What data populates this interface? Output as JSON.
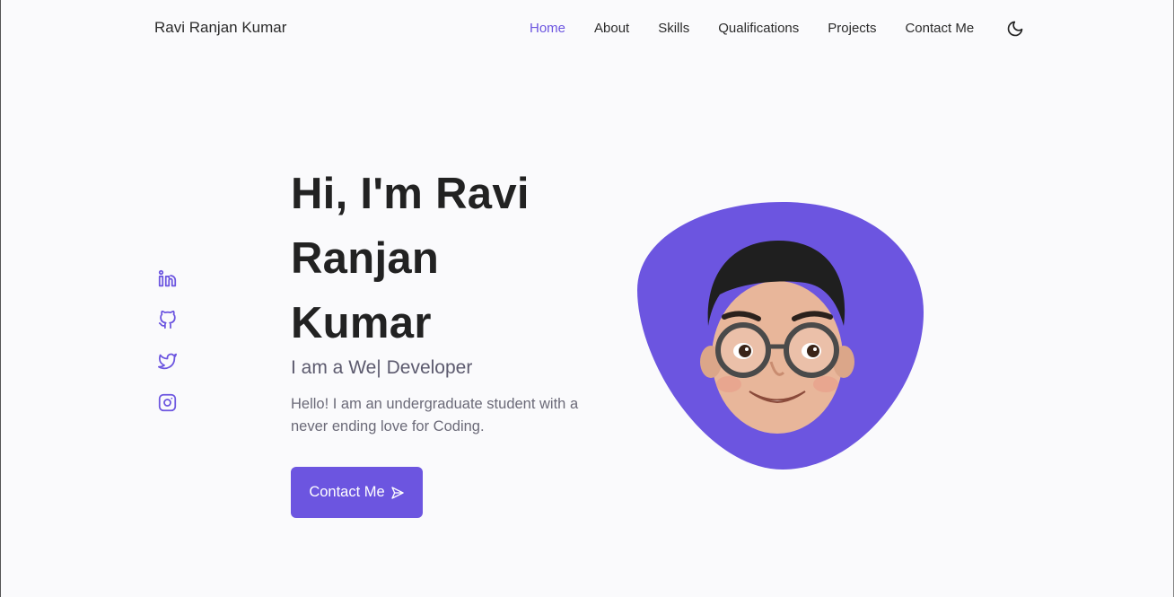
{
  "header": {
    "brand": "Ravi Ranjan Kumar",
    "nav": [
      {
        "label": "Home",
        "active": true
      },
      {
        "label": "About",
        "active": false
      },
      {
        "label": "Skills",
        "active": false
      },
      {
        "label": "Qualifications",
        "active": false
      },
      {
        "label": "Projects",
        "active": false
      },
      {
        "label": "Contact Me",
        "active": false
      }
    ],
    "theme_icon": "moon-icon"
  },
  "social": [
    "linkedin-icon",
    "github-icon",
    "twitter-icon",
    "instagram-icon"
  ],
  "hero": {
    "title_line1": "Hi, I'm Ravi",
    "title_line2": "Ranjan",
    "title_line3": "Kumar",
    "subtitle": "I am a We| Developer",
    "description": "Hello! I am an undergraduate student with a never ending love for Coding.",
    "cta_label": "Contact Me",
    "cta_icon": "send-icon"
  },
  "colors": {
    "accent": "#6c55e0",
    "background": "#fafafc",
    "text": "#222222",
    "muted": "#6b6a78"
  }
}
